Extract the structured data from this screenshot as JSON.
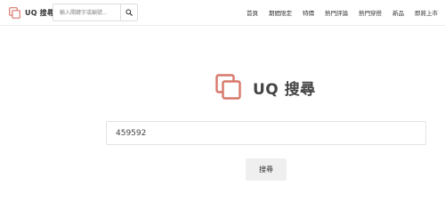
{
  "header": {
    "logo_text": "UQ 搜尋",
    "search_placeholder": "輸入關鍵字或編號...",
    "nav": [
      "首頁",
      "期間限定",
      "特價",
      "熱門評論",
      "熱門穿搭",
      "新品",
      "即將上市"
    ]
  },
  "main": {
    "title": "UQ 搜尋",
    "search_value": "459592",
    "search_button_label": "搜尋"
  },
  "colors": {
    "brand": "#d7786c"
  }
}
